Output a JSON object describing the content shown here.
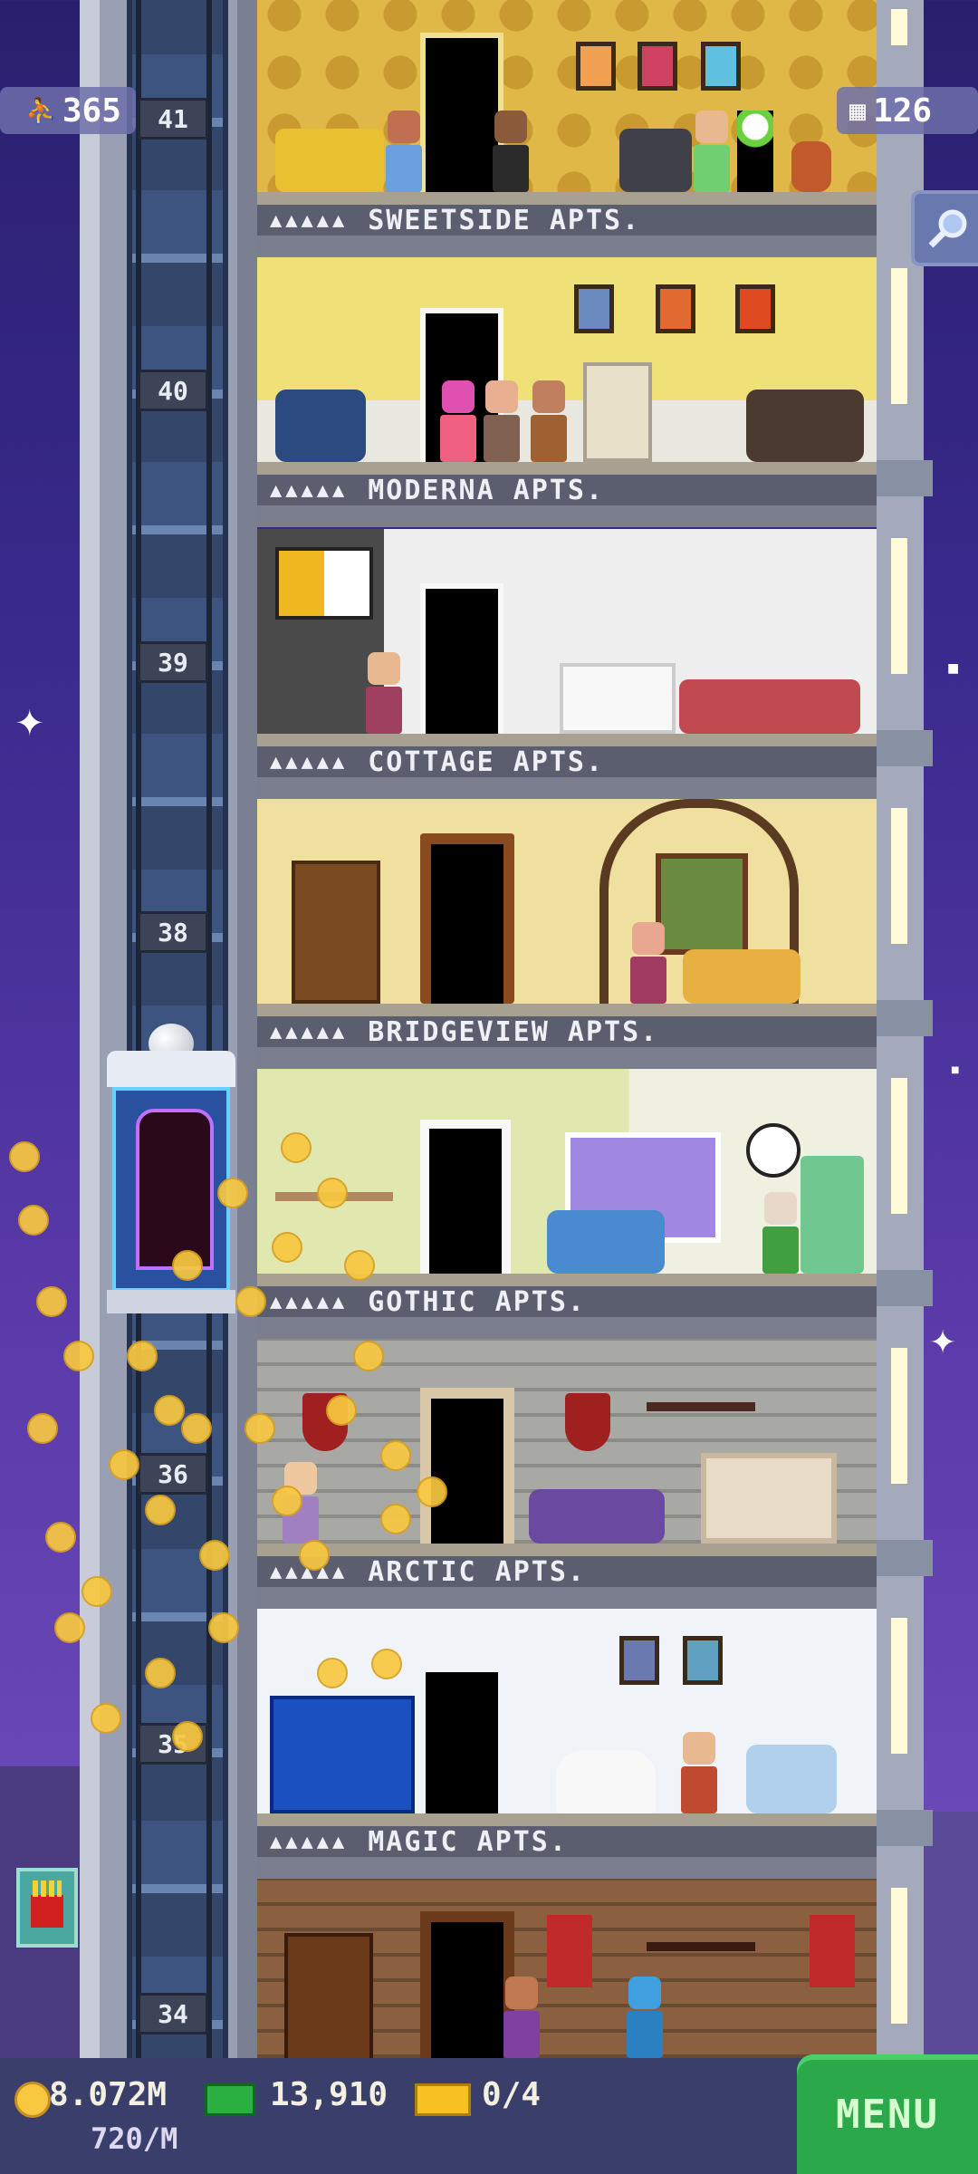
{
  "hud": {
    "population": "365",
    "floors_count": "126",
    "coins": "8.072M",
    "coin_rate": "720/M",
    "bux": "13,910",
    "tickets": "0/4",
    "menu_label": "MENU"
  },
  "floors": [
    {
      "number": "41",
      "name": "SWEETSIDE APTS.",
      "dots": "▲▲▲▲▲"
    },
    {
      "number": "40",
      "name": "MODERNA APTS.",
      "dots": "▲▲▲▲▲"
    },
    {
      "number": "39",
      "name": "COTTAGE APTS.",
      "dots": "▲▲▲▲▲"
    },
    {
      "number": "38",
      "name": "BRIDGEVIEW APTS.",
      "dots": "▲▲▲▲▲"
    },
    {
      "number": "",
      "name": "GOTHIC APTS.",
      "dots": "▲▲▲▲▲"
    },
    {
      "number": "36",
      "name": "ARCTIC APTS.",
      "dots": "▲▲▲▲▲"
    },
    {
      "number": "35",
      "name": "MAGIC APTS.",
      "dots": "▲▲▲▲▲"
    },
    {
      "number": "34",
      "name": "",
      "dots": ""
    }
  ],
  "icons": {
    "population": "person-icon",
    "floors": "building-icon",
    "search": "magnifier-icon",
    "coin": "coin-icon",
    "bux": "bux-icon",
    "ticket": "ticket-icon"
  }
}
